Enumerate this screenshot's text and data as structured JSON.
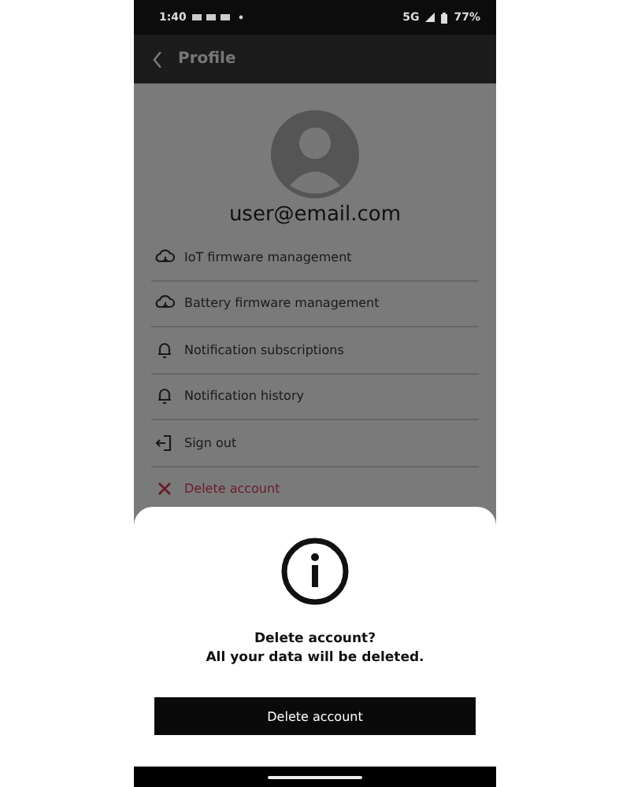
{
  "status_bar": {
    "time": "1:40",
    "network": "5G",
    "battery": "77%"
  },
  "header": {
    "title": "Profile"
  },
  "profile": {
    "email": "user@email.com"
  },
  "menu": [
    {
      "kind": "firmware",
      "label": "IoT firmware management"
    },
    {
      "kind": "firmware",
      "label": "Battery firmware management"
    },
    {
      "kind": "notification",
      "label": "Notification subscriptions"
    },
    {
      "kind": "notification",
      "label": "Notification history"
    },
    {
      "kind": "signout",
      "label": "Sign out"
    },
    {
      "kind": "delete",
      "label": "Delete account"
    }
  ],
  "dialog": {
    "title": "Delete account?",
    "message": "All your data will be deleted.",
    "button": "Delete account"
  }
}
